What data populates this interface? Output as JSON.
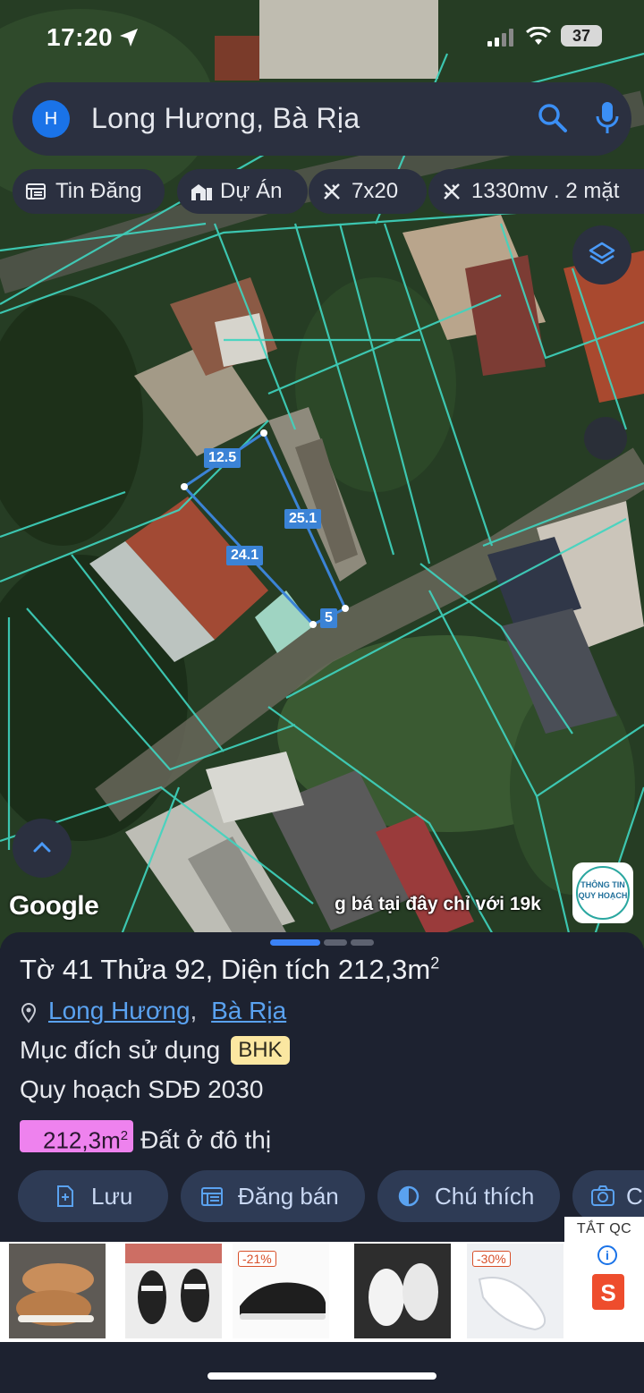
{
  "status_bar": {
    "time": "17:20",
    "battery": "37"
  },
  "search": {
    "avatar_letter": "H",
    "query": "Long Hương, Bà Rịa"
  },
  "chips": [
    {
      "label": "Tin Đăng",
      "icon": "newspaper-icon"
    },
    {
      "label": "Dự Án",
      "icon": "building-icon"
    },
    {
      "label": "7x20",
      "icon": "ruler-icon"
    },
    {
      "label": "1330mv . 2 mặt",
      "icon": "ruler-icon"
    }
  ],
  "map": {
    "attribution": "Google",
    "promo": "g bá tại đây chỉ với 19k",
    "badge_line1": "THÔNG TIN",
    "badge_line2": "QUY HOẠCH",
    "measure_labels": [
      "12.5",
      "25.1",
      "24.1",
      "5"
    ]
  },
  "parcel": {
    "title_prefix": "Tờ 41 Thửa 92, Diện tích 212,3m",
    "title_sup": "2",
    "ward": "Long Hương",
    "comma": ",",
    "city": "Bà Rịa",
    "purpose_label": "Mục đích sử dụng",
    "purpose_code": "BHK",
    "plan": "Quy hoạch SDĐ 2030",
    "area_value": "212,3m",
    "area_sup": "2",
    "area_type": "Đất ở đô thị"
  },
  "actions": [
    {
      "label": "Lưu",
      "icon": "save-icon"
    },
    {
      "label": "Đăng bán",
      "icon": "calendar-icon"
    },
    {
      "label": "Chú thích",
      "icon": "contrast-icon"
    },
    {
      "label": "C",
      "icon": "camera-icon"
    }
  ],
  "ads": {
    "close_label": "TẮT QC",
    "discounts": [
      "-21%",
      "-30%"
    ],
    "shopee_letter": "S",
    "info_letter": "i"
  }
}
